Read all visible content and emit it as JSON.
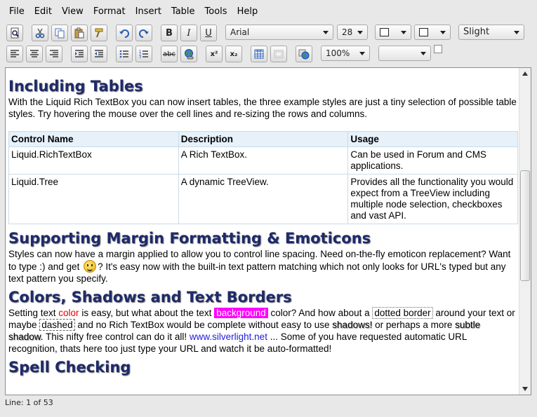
{
  "menu": [
    "File",
    "Edit",
    "View",
    "Format",
    "Insert",
    "Table",
    "Tools",
    "Help"
  ],
  "toolbar": {
    "bold": "B",
    "italic": "I",
    "underline": "U",
    "font_family": "Arial",
    "font_size": "28",
    "shadow_style": "Slight",
    "zoom": "100%",
    "style_select": "",
    "strike": "abc",
    "superscript": "x²",
    "subscript": "x₂"
  },
  "document": {
    "h1": "Including Tables",
    "p1": "With the Liquid Rich TextBox you can now insert tables, the three example styles are just a tiny selection of possible table styles.  Try hovering the mouse over the cell lines and re-sizing the rows and columns.",
    "table": {
      "headers": [
        "Control Name",
        "Description",
        "Usage"
      ],
      "rows": [
        [
          "Liquid.RichTextBox",
          "A Rich TextBox.",
          "Can be used in Forum and CMS applications."
        ],
        [
          "Liquid.Tree",
          "A dynamic TreeView.",
          "Provides all the functionality you would expect from a TreeView including multiple node selection, checkboxes and vast API."
        ]
      ]
    },
    "h2": "Supporting Margin Formatting & Emoticons",
    "p2a": "Styles can now have a margin applied to allow you to control line spacing.  Need on-the-fly emoticon replacement?  Want to type :) and get ",
    "p2b": "?  It's easy now with the built-in text pattern matching which not only looks for URL's typed but any text pattern you specify.",
    "h3": "Colors, Shadows and Text Borders",
    "p3": {
      "t1": "Setting text ",
      "red_word": "color",
      "t2": " is easy, but what about the text ",
      "bg_word": "background",
      "t3": " color?  And how about a ",
      "dotted_word": "dotted border",
      "t4": " around your text or maybe ",
      "dashed_word": "dashed",
      "t5": " and no Rich TextBox would be complete without easy to use ",
      "shadow1": "shadows!",
      "t6": " or perhaps a more ",
      "shadow2": "subtle shadow",
      "t7": ".  This nifty free control can do it all!  ",
      "link": "www.silverlight.net",
      "t8": " ... Some of you have requested automatic URL recognition, thats here too just type your URL and watch it be auto-formatted!"
    },
    "h4": "Spell Checking"
  },
  "status": "Line: 1 of 53",
  "colors": {
    "heading": "#1e2a6a",
    "background_highlight": "#ff00ff",
    "red_text": "#e00000",
    "link": "#2020e0"
  }
}
